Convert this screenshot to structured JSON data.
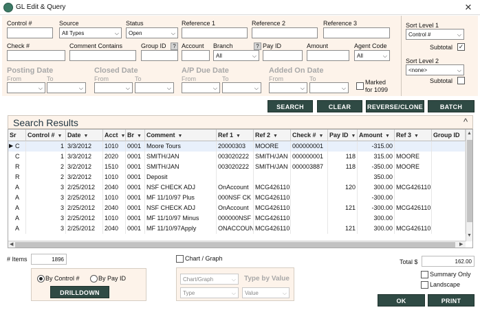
{
  "window": {
    "title": "GL Edit & Query",
    "close_glyph": "✕"
  },
  "filters": {
    "control_label": "Control #",
    "control_value": "",
    "source_label": "Source",
    "source_value": "All Types",
    "status_label": "Status",
    "status_value": "Open",
    "ref1_label": "Reference 1",
    "ref2_label": "Reference 2",
    "ref3_label": "Reference 3",
    "check_label": "Check #",
    "comment_label": "Comment Contains",
    "groupid_label": "Group ID",
    "account_label": "Account",
    "branch_label": "Branch",
    "branch_value": "All",
    "payid_label": "Pay ID",
    "amount_label": "Amount",
    "agent_label": "Agent Code",
    "agent_value": "All",
    "help_glyph": "?",
    "posting_date_label": "Posting Date",
    "closed_date_label": "Closed Date",
    "ap_due_date_label": "A/P Due Date",
    "added_on_date_label": "Added On Date",
    "from_label": "From",
    "to_label": "To",
    "marked_label_1": "Marked",
    "marked_label_2": "for 1099"
  },
  "sort": {
    "level1_label": "Sort Level 1",
    "level1_value": "Control #",
    "subtotal1_label": "Subtotal",
    "subtotal1_checked": "✓",
    "level2_label": "Sort Level 2",
    "level2_value": "<none>",
    "subtotal2_label": "Subtotal"
  },
  "actions": {
    "search_label": "SEARCH",
    "clear_label": "CLEAR",
    "reverse_label": "REVERSE/CLONE",
    "batch_label": "BATCH"
  },
  "results": {
    "title": "Search Results",
    "collapse_glyph": "^",
    "columns": [
      "Sr",
      "Control #",
      "Date",
      "Acct",
      "Br",
      "Comment",
      "Ref 1",
      "Ref 2",
      "Check #",
      "Pay ID",
      "Amount",
      "Ref 3",
      "Group ID"
    ],
    "sort_glyph": "▼",
    "row_pointer": "▶",
    "rows": [
      [
        "C",
        "1",
        "3/3/2012",
        "1010",
        "0001",
        "Moore Tours",
        "20000303",
        "MOORE",
        "000000001",
        "",
        "-315.00",
        "",
        ""
      ],
      [
        "C",
        "1",
        "3/3/2012",
        "2020",
        "0001",
        "SMITH/JAN",
        "003020222",
        "SMITH/JAN",
        "000000001",
        "118",
        "315.00",
        "MOORE",
        ""
      ],
      [
        "R",
        "2",
        "3/2/2012",
        "1510",
        "0001",
        "SMITH/JAN",
        "003020222",
        "SMITH/JAN",
        "000003887",
        "118",
        "-350.00",
        "MOORE",
        ""
      ],
      [
        "R",
        "2",
        "3/2/2012",
        "1010",
        "0001",
        "Deposit",
        "",
        "",
        "",
        "",
        "350.00",
        "",
        ""
      ],
      [
        "A",
        "3",
        "2/25/2012",
        "2040",
        "0001",
        "NSF CHECK ADJ",
        "OnAccount",
        "MCG426110",
        "",
        "120",
        "300.00",
        "MCG426110",
        ""
      ],
      [
        "A",
        "3",
        "2/25/2012",
        "1010",
        "0001",
        "MF 11/10/97 Plus",
        "000NSF CK",
        "MCG426110",
        "",
        "",
        "-300.00",
        "",
        ""
      ],
      [
        "A",
        "3",
        "2/25/2012",
        "2040",
        "0001",
        "NSF CHECK ADJ",
        "OnAccount",
        "MCG426110",
        "",
        "121",
        "-300.00",
        "MCG426110",
        ""
      ],
      [
        "A",
        "3",
        "2/25/2012",
        "1010",
        "0001",
        "MF 11/10/97 Minus",
        "000000NSF",
        "MCG426110",
        "",
        "",
        "300.00",
        "",
        ""
      ],
      [
        "A",
        "3",
        "2/25/2012",
        "2040",
        "0001",
        "MF 11/10/97Apply",
        "ONACCOUN",
        "MCG426110",
        "",
        "121",
        "300.00",
        "MCG426110",
        ""
      ]
    ]
  },
  "footer": {
    "items_label": "# Items",
    "items_value": "1896",
    "by_control_label": "By Control #",
    "by_payid_label": "By Pay ID",
    "drilldown_label": "DRILLDOWN",
    "chart_label": "Chart / Graph",
    "chart_type_value": "Chart/Graph",
    "type_by_value_label": "Type by Value",
    "type_value": "Type",
    "value_value": "Value",
    "total_label": "Total $",
    "total_value": "162.00",
    "summary_only_label": "Summary Only",
    "landscape_label": "Landscape",
    "ok_label": "OK",
    "print_label": "PRINT"
  }
}
